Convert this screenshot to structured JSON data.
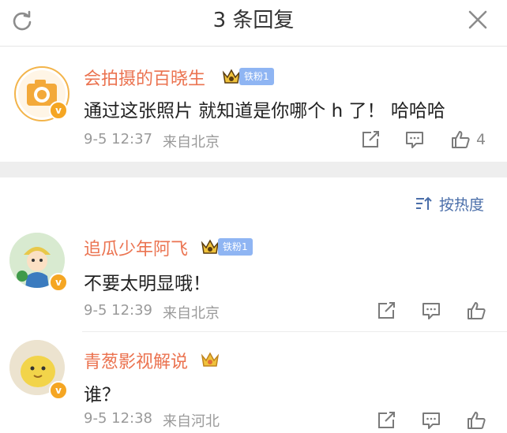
{
  "header": {
    "title": "3 条回复"
  },
  "sort": {
    "label": "按热度"
  },
  "comments": [
    {
      "name": "会拍摄的百晓生",
      "fan_badge": "铁粉1",
      "text": "通过这张照片 就知道是你哪个 h 了！ 哈哈哈",
      "time": "9-5 12:37",
      "location": "来自北京",
      "likes": "4",
      "verified": "v"
    },
    {
      "name": "追瓜少年阿飞",
      "fan_badge": "铁粉1",
      "text": "不要太明显哦！",
      "time": "9-5 12:39",
      "location": "来自北京",
      "verified": "v"
    },
    {
      "name": "青葱影视解说",
      "text": "谁？",
      "time": "9-5 12:38",
      "location": "来自河北",
      "verified": "v"
    }
  ],
  "colors": {
    "name": "#eb7350",
    "fan_badge": "#8fb5f3",
    "sort": "#4a6ea9",
    "verified": "#f5a623"
  },
  "icons": [
    "refresh-icon",
    "close-icon",
    "crown-icon",
    "share-icon",
    "comment-icon",
    "like-icon",
    "sort-icon"
  ]
}
